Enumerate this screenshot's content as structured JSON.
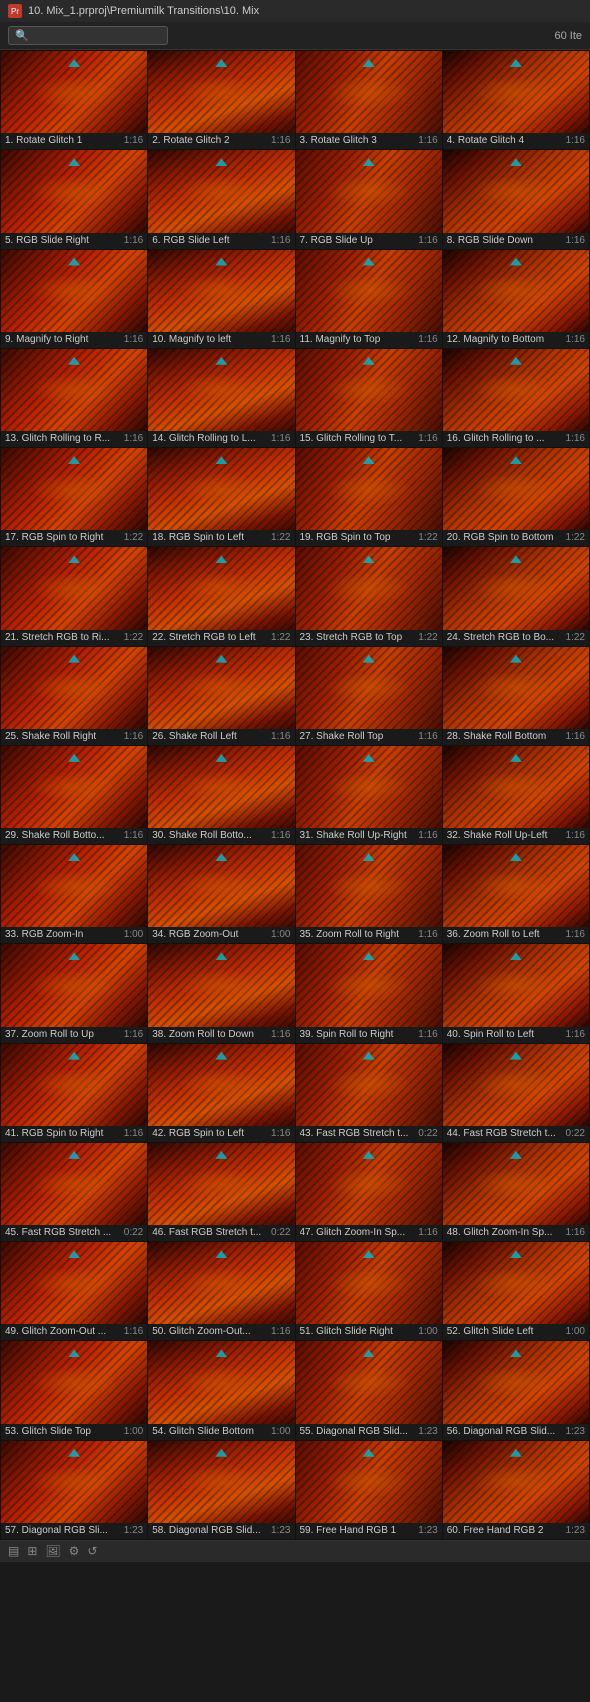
{
  "titleBar": {
    "icon": "Pr",
    "text": "10. Mix_1.prproj\\Premiumilk Transitions\\10. Mix"
  },
  "toolbar": {
    "searchPlaceholder": "",
    "itemCount": "60 Ite"
  },
  "items": [
    {
      "id": 1,
      "name": "1. Rotate Glitch 1",
      "duration": "1:16"
    },
    {
      "id": 2,
      "name": "2. Rotate Glitch 2",
      "duration": "1:16"
    },
    {
      "id": 3,
      "name": "3. Rotate Glitch 3",
      "duration": "1:16"
    },
    {
      "id": 4,
      "name": "4. Rotate Glitch 4",
      "duration": "1:16"
    },
    {
      "id": 5,
      "name": "5. RGB Slide Right",
      "duration": "1:16"
    },
    {
      "id": 6,
      "name": "6. RGB Slide Left",
      "duration": "1:16"
    },
    {
      "id": 7,
      "name": "7. RGB Slide Up",
      "duration": "1:16"
    },
    {
      "id": 8,
      "name": "8. RGB Slide Down",
      "duration": "1:16"
    },
    {
      "id": 9,
      "name": "9. Magnify to Right",
      "duration": "1:16"
    },
    {
      "id": 10,
      "name": "10. Magnify to left",
      "duration": "1:16"
    },
    {
      "id": 11,
      "name": "11. Magnify to Top",
      "duration": "1:16"
    },
    {
      "id": 12,
      "name": "12. Magnify to Bottom",
      "duration": "1:16"
    },
    {
      "id": 13,
      "name": "13. Glitch Rolling to R...",
      "duration": "1:16"
    },
    {
      "id": 14,
      "name": "14. Glitch Rolling to L...",
      "duration": "1:16"
    },
    {
      "id": 15,
      "name": "15. Glitch Rolling to T...",
      "duration": "1:16"
    },
    {
      "id": 16,
      "name": "16. Glitch Rolling to ...",
      "duration": "1:16"
    },
    {
      "id": 17,
      "name": "17. RGB Spin to Right",
      "duration": "1:22"
    },
    {
      "id": 18,
      "name": "18. RGB Spin to Left",
      "duration": "1:22"
    },
    {
      "id": 19,
      "name": "19. RGB Spin to Top",
      "duration": "1:22"
    },
    {
      "id": 20,
      "name": "20. RGB Spin to Bottom",
      "duration": "1:22"
    },
    {
      "id": 21,
      "name": "21. Stretch RGB to Ri...",
      "duration": "1:22"
    },
    {
      "id": 22,
      "name": "22. Stretch RGB to Left",
      "duration": "1:22"
    },
    {
      "id": 23,
      "name": "23. Stretch RGB to Top",
      "duration": "1:22"
    },
    {
      "id": 24,
      "name": "24. Stretch RGB to Bo...",
      "duration": "1:22"
    },
    {
      "id": 25,
      "name": "25. Shake Roll Right",
      "duration": "1:16"
    },
    {
      "id": 26,
      "name": "26. Shake Roll Left",
      "duration": "1:16"
    },
    {
      "id": 27,
      "name": "27. Shake Roll Top",
      "duration": "1:16"
    },
    {
      "id": 28,
      "name": "28. Shake Roll Bottom",
      "duration": "1:16"
    },
    {
      "id": 29,
      "name": "29. Shake Roll Botto...",
      "duration": "1:16"
    },
    {
      "id": 30,
      "name": "30. Shake Roll Botto...",
      "duration": "1:16"
    },
    {
      "id": 31,
      "name": "31. Shake Roll Up-Right",
      "duration": "1:16"
    },
    {
      "id": 32,
      "name": "32. Shake Roll Up-Left",
      "duration": "1:16"
    },
    {
      "id": 33,
      "name": "33. RGB Zoom-In",
      "duration": "1:00"
    },
    {
      "id": 34,
      "name": "34. RGB Zoom-Out",
      "duration": "1:00"
    },
    {
      "id": 35,
      "name": "35. Zoom Roll to Right",
      "duration": "1:16"
    },
    {
      "id": 36,
      "name": "36. Zoom Roll to Left",
      "duration": "1:16"
    },
    {
      "id": 37,
      "name": "37. Zoom Roll to Up",
      "duration": "1:16"
    },
    {
      "id": 38,
      "name": "38. Zoom Roll to Down",
      "duration": "1:16"
    },
    {
      "id": 39,
      "name": "39. Spin Roll to Right",
      "duration": "1:16"
    },
    {
      "id": 40,
      "name": "40. Spin Roll to Left",
      "duration": "1:16"
    },
    {
      "id": 41,
      "name": "41. RGB Spin to Right",
      "duration": "1:16"
    },
    {
      "id": 42,
      "name": "42. RGB Spin to Left",
      "duration": "1:16"
    },
    {
      "id": 43,
      "name": "43. Fast RGB Stretch t...",
      "duration": "0:22"
    },
    {
      "id": 44,
      "name": "44. Fast RGB Stretch t...",
      "duration": "0:22"
    },
    {
      "id": 45,
      "name": "45. Fast RGB Stretch ...",
      "duration": "0:22"
    },
    {
      "id": 46,
      "name": "46. Fast RGB Stretch t...",
      "duration": "0:22"
    },
    {
      "id": 47,
      "name": "47. Glitch Zoom-In Sp...",
      "duration": "1:16"
    },
    {
      "id": 48,
      "name": "48. Glitch Zoom-In Sp...",
      "duration": "1:16"
    },
    {
      "id": 49,
      "name": "49. Glitch Zoom-Out ...",
      "duration": "1:16"
    },
    {
      "id": 50,
      "name": "50. Glitch Zoom-Out...",
      "duration": "1:16"
    },
    {
      "id": 51,
      "name": "51. Glitch Slide Right",
      "duration": "1:00"
    },
    {
      "id": 52,
      "name": "52. Glitch Slide Left",
      "duration": "1:00"
    },
    {
      "id": 53,
      "name": "53. Glitch Slide Top",
      "duration": "1:00"
    },
    {
      "id": 54,
      "name": "54. Glitch Slide Bottom",
      "duration": "1:00"
    },
    {
      "id": 55,
      "name": "55. Diagonal RGB Slid...",
      "duration": "1:23"
    },
    {
      "id": 56,
      "name": "56. Diagonal RGB Slid...",
      "duration": "1:23"
    },
    {
      "id": 57,
      "name": "57. Diagonal RGB Sli...",
      "duration": "1:23"
    },
    {
      "id": 58,
      "name": "58. Diagonal RGB Slid...",
      "duration": "1:23"
    },
    {
      "id": 59,
      "name": "59. Free Hand RGB 1",
      "duration": "1:23"
    },
    {
      "id": 60,
      "name": "60. Free Hand RGB 2",
      "duration": "1:23"
    }
  ]
}
